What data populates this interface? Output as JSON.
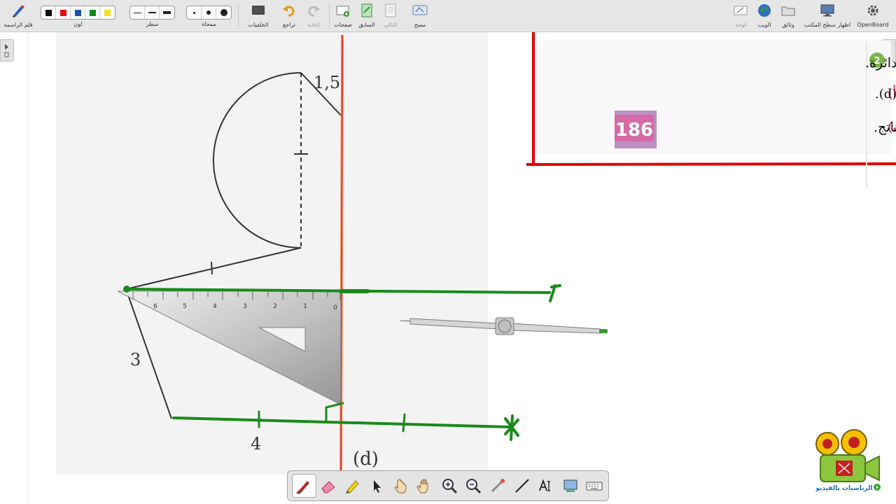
{
  "toolbar": {
    "items": {
      "pen": "قلم الراسمة",
      "color": "لون",
      "line": "سطر",
      "eraser_size": "ممحاة",
      "backgrounds": "الخلفيات",
      "undo": "تراجع",
      "redo": "إعادة",
      "pages": "صفحات",
      "previous": "السابق",
      "next": "التالي",
      "erase": "مسح",
      "board": "لوحة",
      "web": "الويب",
      "documents": "وثائق",
      "show_desktop": "اظهار سطح المكتب",
      "openboard": "OpenBoard"
    },
    "colors": [
      "#000000",
      "#e01010",
      "#1a4fb0",
      "#0f8a1f",
      "#f0e020"
    ]
  },
  "exercise": {
    "number": "2",
    "line1": "وحدة الطّول هي السنتيمتر، والقوس هي نصف دائرة.",
    "line2_marker": "أ)",
    "line2": "انقل الشّكل المرفق وأكمله بالتناظر بالنّسبة إلى المستقيم (d).",
    "line3_marker": "ب)",
    "line3": "احسب محيط الشّكل الناتج.",
    "page_badge": "186"
  },
  "figure": {
    "label_top": "1,5",
    "label_left": "3",
    "label_bottom": "4",
    "axis_label": "(d)",
    "ruler_ticks": [
      "6",
      "5",
      "4",
      "3",
      "2",
      "1",
      "0"
    ]
  },
  "logo": {
    "caption": "الرياضيات بالفيديو"
  },
  "dock": {
    "tools": [
      "pen-tool",
      "eraser-tool",
      "highlighter-tool",
      "selector-tool",
      "interact-tool",
      "hand-tool",
      "zoom-in-tool",
      "zoom-out-tool",
      "laser-tool",
      "line-tool",
      "text-tool",
      "capture-tool",
      "keyboard-tool"
    ],
    "selected": "pen-tool"
  }
}
